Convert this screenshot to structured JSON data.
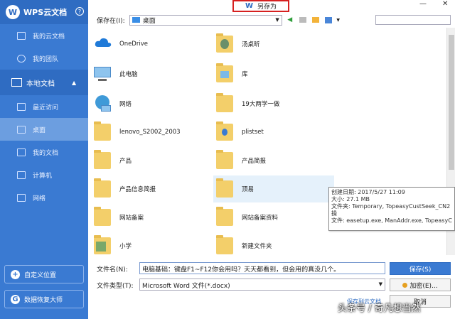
{
  "sidebar": {
    "title": "WPS云文档",
    "help": "?",
    "items_top": [
      {
        "label": "我的云文档"
      },
      {
        "label": "我的团队"
      }
    ],
    "section": {
      "label": "本地文档",
      "caret": "▲"
    },
    "items_local": [
      {
        "label": "最近访问"
      },
      {
        "label": "桌面"
      },
      {
        "label": "我的文档"
      },
      {
        "label": "计算机"
      },
      {
        "label": "网络"
      }
    ],
    "custom_location": "自定义位置",
    "custom_plus": "+",
    "data_recovery": "数据恢复大师",
    "recovery_icon": "G"
  },
  "dialog": {
    "title": "另存为",
    "title_glyph": "W",
    "minimize": "—",
    "close": "✕"
  },
  "toolbar": {
    "save_in_label": "保存在(I):",
    "save_in_value": "桌面",
    "combo_arrow": "▼",
    "back": "◀",
    "view_arrow": "▼"
  },
  "files": [
    {
      "name": "OneDrive",
      "icon": "cloud-icon"
    },
    {
      "name": "汤桌昕",
      "icon": "user-folder-icon"
    },
    {
      "name": "此电脑",
      "icon": "computer-icon"
    },
    {
      "name": "库",
      "icon": "library-icon"
    },
    {
      "name": "网络",
      "icon": "network-icon"
    },
    {
      "name": "19大两学一做",
      "icon": "folder-icon"
    },
    {
      "name": "lenovo_S2002_2003",
      "icon": "folder-icon"
    },
    {
      "name": "plistset",
      "icon": "folder-icon"
    },
    {
      "name": "产品",
      "icon": "folder-icon"
    },
    {
      "name": "产品简报",
      "icon": "folder-icon"
    },
    {
      "name": "产品信息简报",
      "icon": "folder-icon"
    },
    {
      "name": "顶易",
      "icon": "folder-icon"
    },
    {
      "name": "网站备案",
      "icon": "folder-icon"
    },
    {
      "name": "网站备案资料",
      "icon": "folder-icon"
    },
    {
      "name": "小学",
      "icon": "folder-icon"
    },
    {
      "name": "新建文件夹",
      "icon": "folder-icon"
    }
  ],
  "tooltip": {
    "lines": [
      "创建日期: 2017/5/27 11:09",
      "大小: 27.1 MB",
      "文件夹: Temporary, TopeasyCustSeek_CN2",
      "操",
      "文件: easetup.exe, ManAddr.exe, TopeasyC"
    ]
  },
  "form": {
    "filename_label": "文件名(N):",
    "filename_value": "电脑基础：键盘F1~F12你会用吗？天天都看到，但会用的真没几个。",
    "filetype_label": "文件类型(T):",
    "filetype_value": "Microsoft Word 文件(*.docx)",
    "save_button": "保存(S)",
    "encrypt_button": "加密(E)...",
    "cancel_button": "取消",
    "cloud_link": "保存到云文档",
    "dropdown_arrow": "▼"
  },
  "watermark": "头条号 / 奇凡想当然",
  "colors": {
    "sidebar_bg": "#3a7ad2",
    "highlight_border": "#d62020",
    "folder": "#f3cf6a"
  }
}
